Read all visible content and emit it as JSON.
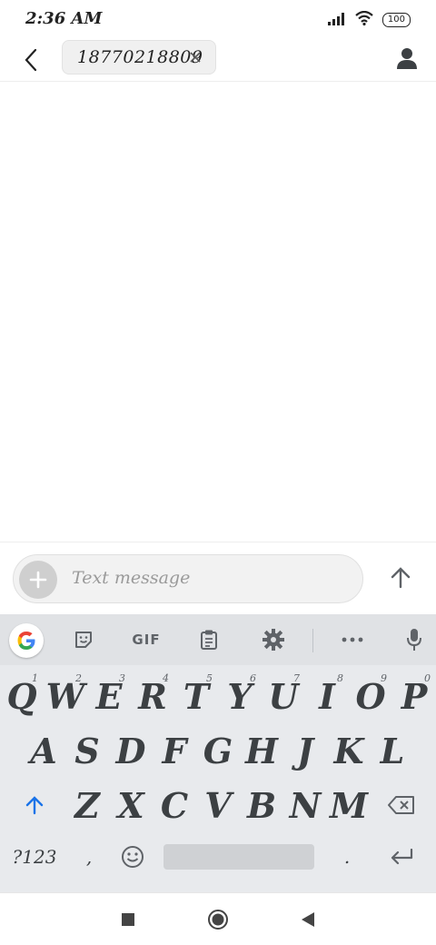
{
  "status_bar": {
    "time": "2:36 AM",
    "battery": "100",
    "icons": [
      "signal-icon",
      "wifi-icon",
      "battery-icon"
    ]
  },
  "header": {
    "back_icon": "back-arrow-icon",
    "recipient": "18770218809",
    "remove_icon": "close-icon",
    "contact_icon": "person-icon"
  },
  "compose": {
    "placeholder": "Text message",
    "attach_icon": "plus-icon",
    "send_icon": "send-arrow-icon"
  },
  "keyboard": {
    "toolbar": {
      "google_icon": "google-g-icon",
      "sticker_icon": "sticker-icon",
      "gif_label": "GIF",
      "clipboard_icon": "clipboard-icon",
      "settings_icon": "gear-icon",
      "more_icon": "more-dots-icon",
      "mic_icon": "mic-icon"
    },
    "row1": [
      {
        "key": "Q",
        "hint": "1"
      },
      {
        "key": "W",
        "hint": "2"
      },
      {
        "key": "E",
        "hint": "3"
      },
      {
        "key": "R",
        "hint": "4"
      },
      {
        "key": "T",
        "hint": "5"
      },
      {
        "key": "Y",
        "hint": "6"
      },
      {
        "key": "U",
        "hint": "7"
      },
      {
        "key": "I",
        "hint": "8"
      },
      {
        "key": "O",
        "hint": "9"
      },
      {
        "key": "P",
        "hint": "0"
      }
    ],
    "row2": [
      "A",
      "S",
      "D",
      "F",
      "G",
      "H",
      "J",
      "K",
      "L"
    ],
    "row3": [
      "Z",
      "X",
      "C",
      "V",
      "B",
      "N",
      "M"
    ],
    "shift_icon": "shift-arrow-icon",
    "backspace_icon": "backspace-icon",
    "row4": {
      "symbols": "?123",
      "comma": ",",
      "emoji_icon": "emoji-icon",
      "period": ".",
      "enter_icon": "enter-icon"
    }
  },
  "nav_bar": {
    "recents_icon": "square-icon",
    "home_icon": "circle-icon",
    "back_icon": "triangle-back-icon"
  },
  "colors": {
    "accent": "#1a73e8",
    "keyboard_bg": "#e8eaed",
    "key_text": "#3c4043"
  }
}
